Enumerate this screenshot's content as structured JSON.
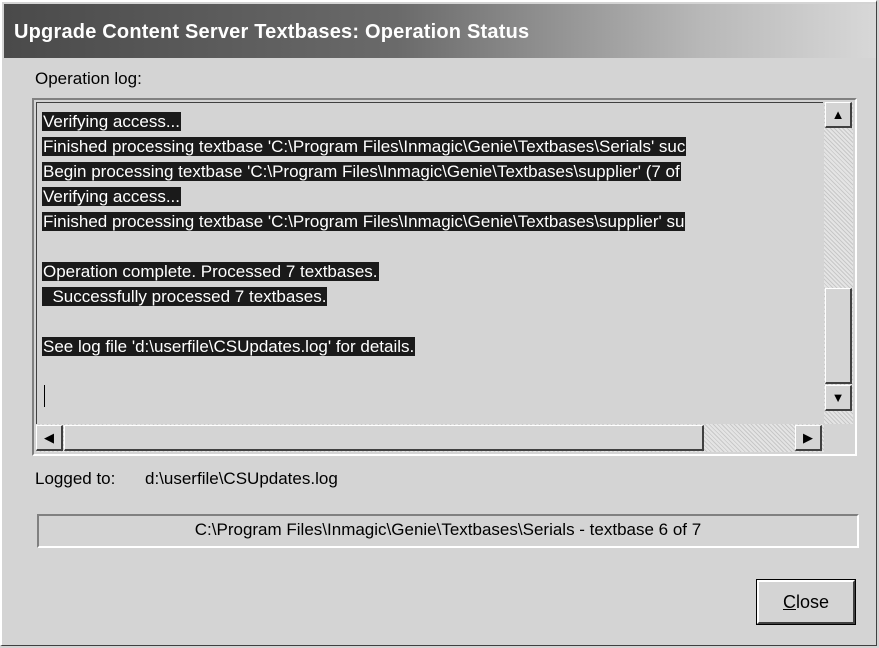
{
  "window": {
    "title": "Upgrade Content Server Textbases: Operation Status"
  },
  "log": {
    "label": "Operation log:",
    "lines": [
      {
        "text": "Verifying access...",
        "selected": true
      },
      {
        "text": "Finished processing textbase 'C:\\Program Files\\Inmagic\\Genie\\Textbases\\Serials' suc",
        "selected": true
      },
      {
        "text": "Begin processing textbase 'C:\\Program Files\\Inmagic\\Genie\\Textbases\\supplier' (7 of",
        "selected": true
      },
      {
        "text": "Verifying access...",
        "selected": true
      },
      {
        "text": "Finished processing textbase 'C:\\Program Files\\Inmagic\\Genie\\Textbases\\supplier' su",
        "selected": true
      },
      {
        "text": "",
        "selected": false
      },
      {
        "text": "Operation complete. Processed 7 textbases.",
        "selected": true
      },
      {
        "text": "  Successfully processed 7 textbases.",
        "selected": true
      },
      {
        "text": "",
        "selected": false
      },
      {
        "text": "See log file 'd:\\userfile\\CSUpdates.log' for details.",
        "selected": true
      }
    ]
  },
  "logged_to": {
    "label": "Logged to:",
    "value": "d:\\userfile\\CSUpdates.log"
  },
  "status": {
    "text": "C:\\Program Files\\Inmagic\\Genie\\Textbases\\Serials - textbase 6 of 7"
  },
  "buttons": {
    "close_mnemonic": "C",
    "close_rest": "lose"
  },
  "icons": {
    "scroll_up": "▲",
    "scroll_down": "▼",
    "scroll_left": "◀",
    "scroll_right": "▶"
  }
}
